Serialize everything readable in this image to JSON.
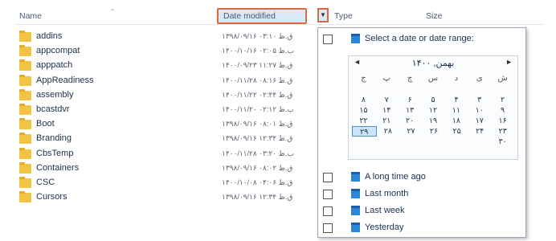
{
  "header": {
    "name": "Name",
    "date_modified": "Date modified",
    "type": "Type",
    "size": "Size",
    "sort_mark": "^",
    "filter_glyph": "▼"
  },
  "rows": [
    {
      "name": "addins",
      "date": "۱۳۹۸/۰۹/۱۶ ق.ظ ۰۳:۱۰"
    },
    {
      "name": "appcompat",
      "date": "۱۴۰۰/۱۰/۱۶ ب.ظ ۰۲:۰۵"
    },
    {
      "name": "apppatch",
      "date": "۱۴۰۰/۰۹/۲۳ ق.ظ ۱۱:۲۷"
    },
    {
      "name": "AppReadiness",
      "date": "۱۴۰۰/۱۱/۲۸ ق.ظ ۰۸:۱۶"
    },
    {
      "name": "assembly",
      "date": "۱۴۰۰/۱۱/۲۲ ق.ظ ۰۲:۴۴"
    },
    {
      "name": "bcastdvr",
      "date": "۱۴۰۰/۱۱/۲۰ ب.ظ ۰۲:۱۲"
    },
    {
      "name": "Boot",
      "date": "۱۳۹۸/۰۹/۱۶ ق.ظ ۰۸:۰۱"
    },
    {
      "name": "Branding",
      "date": "۱۳۹۸/۰۹/۱۶ ق.ظ ۱۲:۳۴"
    },
    {
      "name": "CbsTemp",
      "date": "۱۴۰۰/۱۱/۲۸ ب.ظ ۰۳:۲۰"
    },
    {
      "name": "Containers",
      "date": "۱۳۹۸/۰۹/۱۶ ق.ظ ۰۸:۰۲"
    },
    {
      "name": "CSC",
      "date": "۱۴۰۰/۱۰/۰۸ ق.ظ ۰۴:۰۶"
    },
    {
      "name": "Cursors",
      "date": "۱۳۹۸/۰۹/۱۶ ق.ظ ۱۲:۳۴"
    }
  ],
  "dropdown": {
    "select_range": "Select a date or date range:",
    "calendar": {
      "month": "بهمن, ۱۴۰۰",
      "prev": "◄",
      "next": "►",
      "weekdays": [
        "ش",
        "ی",
        "د",
        "س",
        "چ",
        "پ",
        "ج"
      ],
      "weeks": [
        [
          "۲",
          "۳",
          "۴",
          "۵",
          "۶",
          "۷",
          "۸"
        ],
        [
          "۹",
          "۱۰",
          "۱۱",
          "۱۲",
          "۱۳",
          "۱۴",
          "۱۵"
        ],
        [
          "۱۶",
          "۱۷",
          "۱۸",
          "۱۹",
          "۲۰",
          "۲۱",
          "۲۲"
        ],
        [
          "۲۳",
          "۲۴",
          "۲۵",
          "۲۶",
          "۲۷",
          "۲۸",
          "۲۹"
        ],
        [
          "۳۰",
          "",
          "",
          "",
          "",
          "",
          ""
        ]
      ],
      "selected_day": "۲۹"
    },
    "options": [
      {
        "label": "A long time ago"
      },
      {
        "label": "Last month"
      },
      {
        "label": "Last week"
      },
      {
        "label": "Yesterday"
      }
    ]
  },
  "colors": {
    "highlight_border": "#d86a43",
    "folder": "#f3c344",
    "calendar_icon": "#2d86d6"
  }
}
